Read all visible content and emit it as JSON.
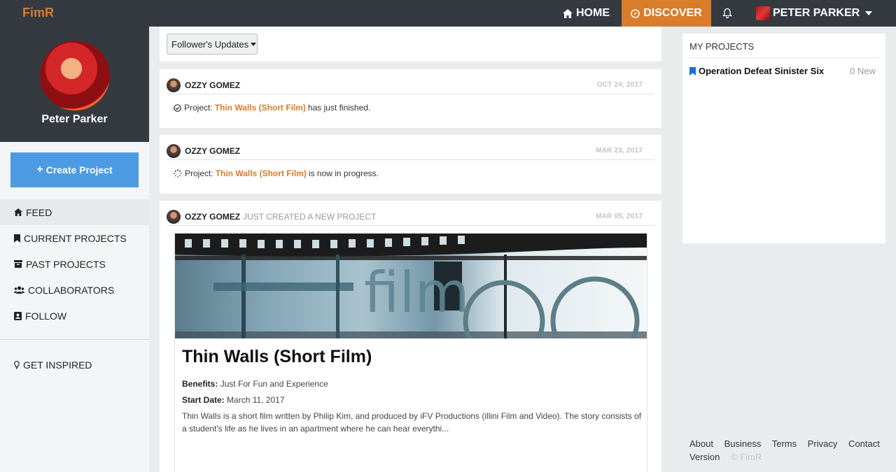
{
  "app": {
    "brand": "FimR"
  },
  "nav": {
    "home": "HOME",
    "discover": "DISCOVER",
    "user": "PETER PARKER",
    "accent": "#d97c2b",
    "bar_color": "#343a40"
  },
  "sidebar": {
    "profile_name": "Peter Parker",
    "create_label": "Create Project",
    "items": [
      {
        "label": "FEED",
        "icon": "home-icon",
        "active": true
      },
      {
        "label": "CURRENT PROJECTS",
        "icon": "bookmark-icon"
      },
      {
        "label": "PAST PROJECTS",
        "icon": "archive-icon"
      },
      {
        "label": "COLLABORATORS",
        "icon": "users-icon"
      },
      {
        "label": "FOLLOW",
        "icon": "address-book-icon"
      }
    ],
    "inspired": "GET INSPIRED"
  },
  "feed": {
    "filter_label": "Follower's Updates",
    "posts": [
      {
        "author": "OZZY GOMEZ",
        "date": "OCT 24, 2017",
        "prefix": "Project:",
        "project": "Thin Walls (Short Film)",
        "suffix": "has just finished."
      },
      {
        "author": "OZZY GOMEZ",
        "date": "MAR 23, 2017",
        "prefix": "Project:",
        "project": "Thin Walls (Short Film)",
        "suffix": "is now in progress."
      },
      {
        "author": "OZZY GOMEZ",
        "action": "JUST CREATED A NEW PROJECT",
        "date": "MAR 05, 2017",
        "banner_text": "film",
        "title": "Thin Walls (Short Film)",
        "benefits_label": "Benefits:",
        "benefits": "Just For Fun and Experience",
        "start_label": "Start Date:",
        "start": "March 11, 2017",
        "description": "Thin Walls is a short film written by Philip Kim, and produced by iFV Productions (illini Film and Video). The story consists of a student's life as he lives in an apartment where he can hear everythi..."
      }
    ]
  },
  "right": {
    "heading": "MY PROJECTS",
    "project": "Operation Defeat Sinister Six",
    "count": "0 New",
    "footer": [
      "About",
      "Business",
      "Terms",
      "Privacy",
      "Contact",
      "Version"
    ],
    "copyright": "© FimR"
  }
}
